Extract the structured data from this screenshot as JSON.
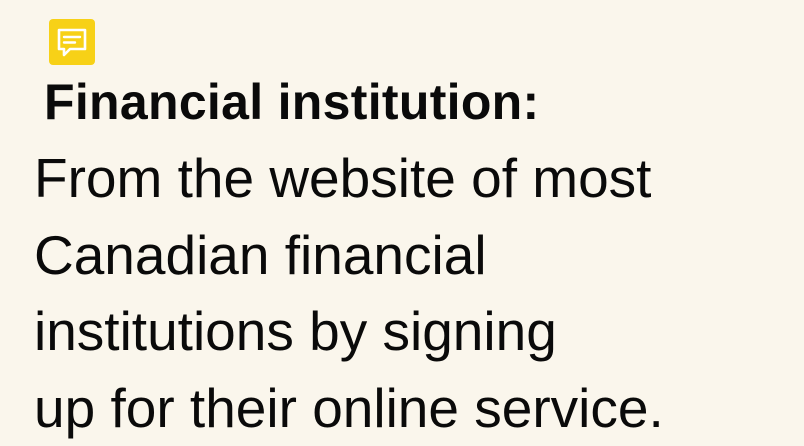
{
  "icon": {
    "name": "comment-note-icon",
    "color": "#f7d117"
  },
  "heading": "Financial institution:",
  "body_lines": [
    "From the website of most",
    "Canadian financial",
    "institutions by signing",
    "up for their online service."
  ]
}
